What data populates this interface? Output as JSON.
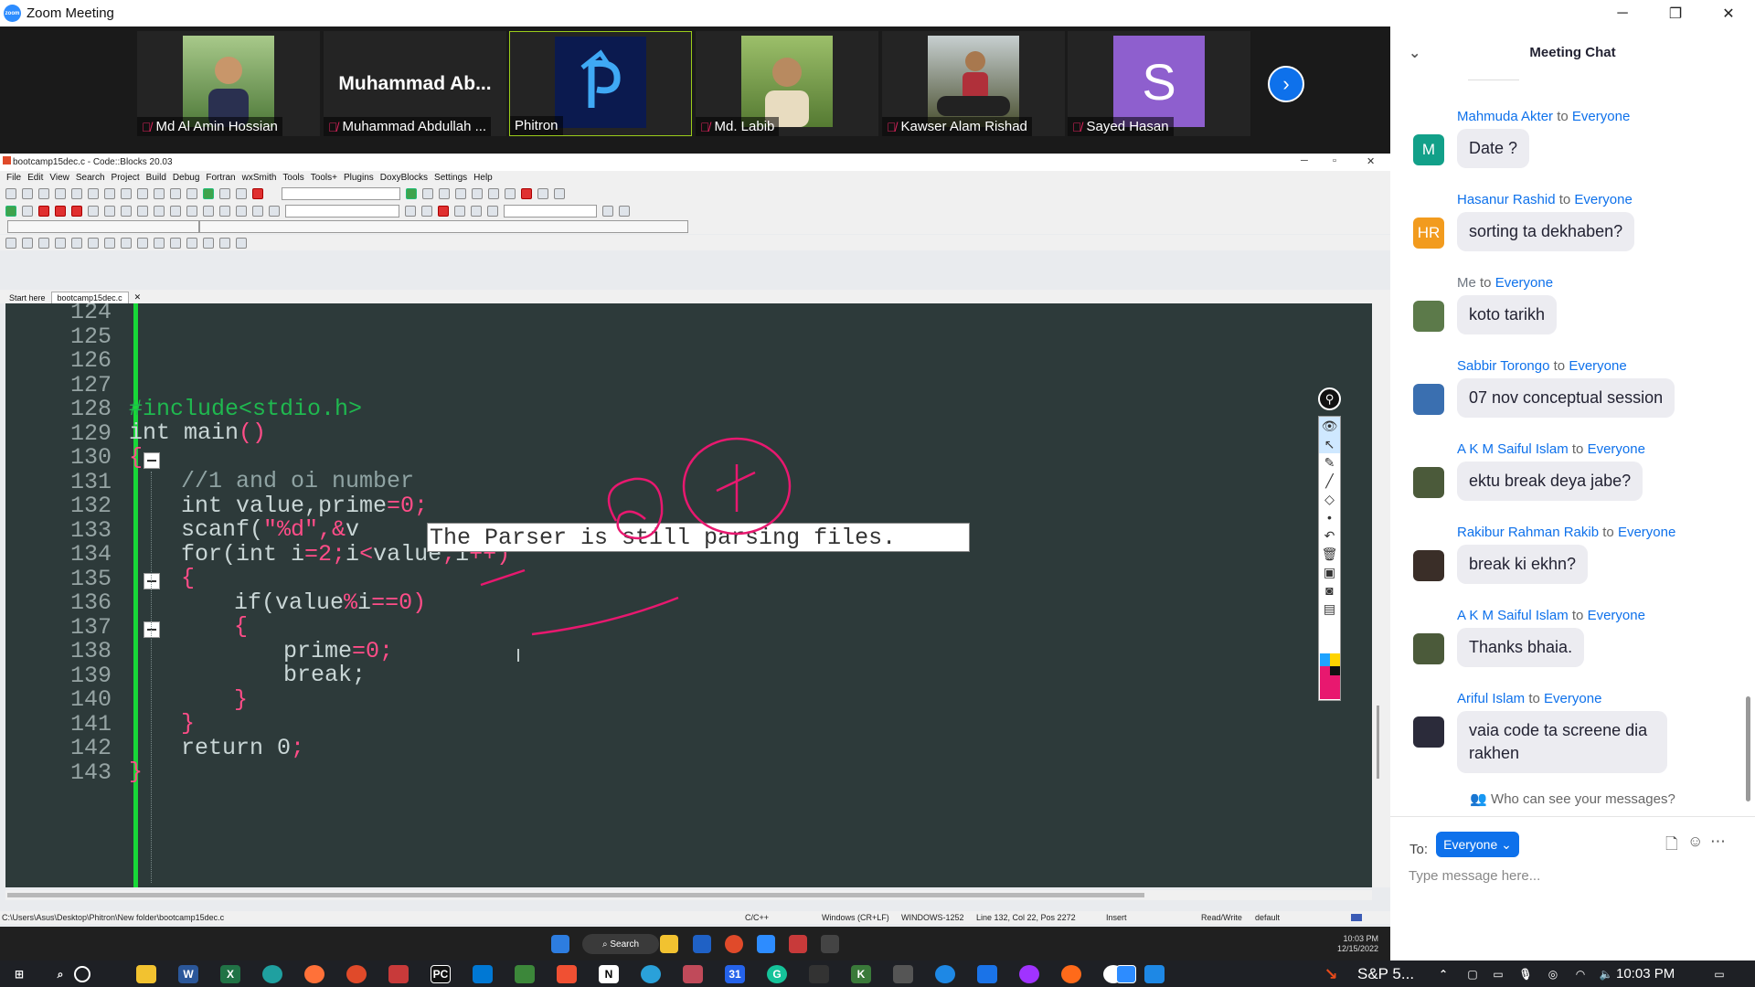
{
  "zoom": {
    "window_title": "Zoom Meeting",
    "logo_text": "zoom",
    "next_label": "›",
    "participants": [
      {
        "name": "Md Al Amin Hossian",
        "muted": true,
        "kind": "photo",
        "color": "#6a8f4e"
      },
      {
        "name": "Muhammad Abdullah ...",
        "big_name": "Muhammad  Ab...",
        "muted": true,
        "kind": "text"
      },
      {
        "name": "Phitron",
        "muted": false,
        "kind": "logo",
        "active": true,
        "color": "#0b1a4f"
      },
      {
        "name": "Md. Labib",
        "muted": true,
        "kind": "photo",
        "color": "#5b7a3a"
      },
      {
        "name": "Kawser Alam Rishad",
        "muted": true,
        "kind": "photo",
        "color": "#4d5a3a"
      },
      {
        "name": "Sayed Hasan",
        "muted": true,
        "kind": "initial",
        "initial": "S",
        "color": "#8e5fce"
      }
    ]
  },
  "codeblocks": {
    "title": "bootcamp15dec.c - Code::Blocks 20.03",
    "menu": [
      "File",
      "Edit",
      "View",
      "Search",
      "Project",
      "Build",
      "Debug",
      "Fortran",
      "wxSmith",
      "Tools",
      "Tools+",
      "Plugins",
      "DoxyBlocks",
      "Settings",
      "Help"
    ],
    "tabs": [
      "Start here",
      "bootcamp15dec.c"
    ],
    "line_numbers": [
      "124",
      "125",
      "126",
      "127",
      "128",
      "129",
      "130",
      "131",
      "132",
      "133",
      "134",
      "135",
      "136",
      "137",
      "138",
      "139",
      "140",
      "141",
      "142",
      "143"
    ],
    "code": {
      "l128": "#include<stdio.h>",
      "l129_kw": "int main",
      "l129_paren": "()",
      "l130": "{",
      "l131": "//1 and oi number",
      "l132_a": "int value,prime",
      "l132_b": "=0;",
      "l133_a": "scanf(",
      "l133_b": "\"%d\",&",
      "l133_c": "v",
      "l134_a": "for(int i",
      "l134_b": "=2;",
      "l134_c": "i",
      "l134_d": "<",
      "l134_e": "value",
      "l134_f": ";",
      "l134_g": "i",
      "l134_h": "++)",
      "l135": "{",
      "l136_a": "if(value",
      "l136_b": "%",
      "l136_c": "i",
      "l136_d": "==0)",
      "l137": "{",
      "l138_a": "prime",
      "l138_b": "=0;",
      "l139": "break;",
      "l140": "}",
      "l141": "}",
      "l142_a": "return 0",
      "l142_b": ";",
      "l143": "}"
    },
    "parser_message": "The Parser is still parsing files.",
    "status": {
      "path": "C:\\Users\\Asus\\Desktop\\Phitron\\New folder\\bootcamp15dec.c",
      "language": "C/C++",
      "line_endings": "Windows (CR+LF)",
      "encoding": "WINDOWS-1252",
      "position": "Line 132, Col 22, Pos 2272",
      "mode": "Insert",
      "access": "Read/Write",
      "profile": "default"
    },
    "inner_taskbar": {
      "search_label": "Search",
      "time": "10:03 PM",
      "date": "12/15/2022"
    }
  },
  "chat": {
    "title": "Meeting Chat",
    "messages": [
      {
        "sender": "Mahmuda Akter",
        "to": "to",
        "recipient": "Everyone",
        "text": "Date ?",
        "avatar_text": "M",
        "avatar_color": "#12a089"
      },
      {
        "sender": "Hasanur Rashid",
        "to": "to",
        "recipient": "Everyone",
        "text": "sorting ta dekhaben?",
        "avatar_text": "HR",
        "avatar_color": "#f29b1e"
      },
      {
        "sender": "Me",
        "to": "to",
        "recipient": "Everyone",
        "text": "koto tarikh",
        "avatar_text": "",
        "avatar_color": "#5c7a4a"
      },
      {
        "sender": "Sabbir Torongo",
        "to": "to",
        "recipient": "Everyone",
        "text": "07 nov conceptual session",
        "avatar_text": "",
        "avatar_color": "#3a6fb0"
      },
      {
        "sender": "A K M Saiful Islam",
        "to": "to",
        "recipient": "Everyone",
        "text": "ektu break deya jabe?",
        "avatar_text": "",
        "avatar_color": "#4b5a3a"
      },
      {
        "sender": "Rakibur Rahman Rakib",
        "to": "to",
        "recipient": "Everyone",
        "text": "break ki ekhn?",
        "avatar_text": "",
        "avatar_color": "#3a2e28"
      },
      {
        "sender": "A K M Saiful Islam",
        "to": "to",
        "recipient": "Everyone",
        "text": "Thanks bhaia.",
        "avatar_text": "",
        "avatar_color": "#4b5a3a"
      },
      {
        "sender": "Ariful Islam",
        "to": "to",
        "recipient": "Everyone",
        "text": "vaia code ta screene dia rakhen",
        "avatar_text": "",
        "avatar_color": "#2b2b3a"
      }
    ],
    "visibility_text": "Who can see your messages?",
    "to_label": "To:",
    "recipient_button": "Everyone",
    "input_placeholder": "Type message here..."
  },
  "taskbar": {
    "time": "10:03 PM",
    "status_text": "S&P 5..."
  },
  "colors": {
    "zoom_blue": "#0e71eb",
    "annotation_pink": "#e8186f",
    "editor_bg": "#2d3a3a",
    "change_bar": "#18d838"
  }
}
